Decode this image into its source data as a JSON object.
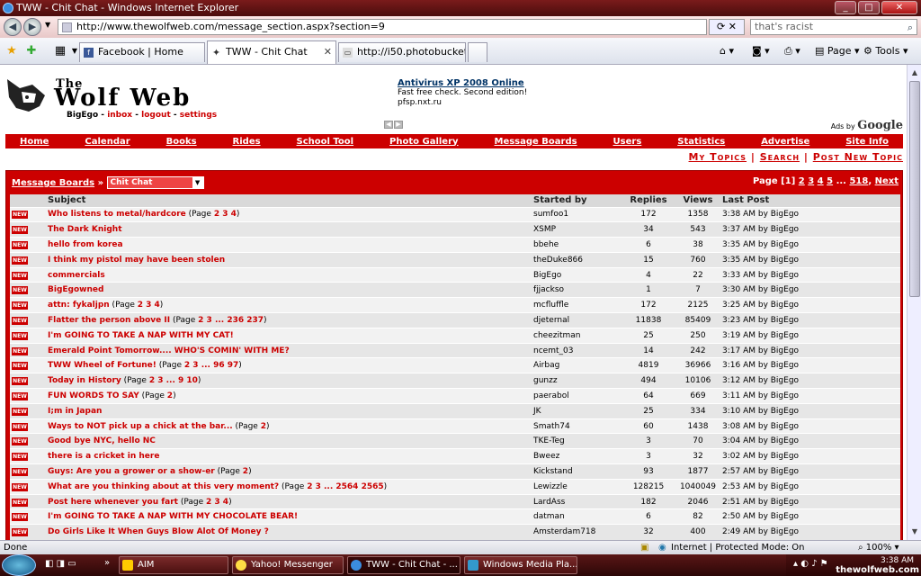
{
  "window": {
    "title": "TWW - Chit Chat - Windows Internet Explorer"
  },
  "address": {
    "url": "http://www.thewolfweb.com/message_section.aspx?section=9",
    "search_text": "that's racist"
  },
  "tabs": [
    {
      "label": "Facebook | Home"
    },
    {
      "label": "TWW - Chit Chat"
    },
    {
      "label": "http://i50.photobucket.co..."
    }
  ],
  "toolbar": {
    "page_label": "Page",
    "tools_label": "Tools"
  },
  "site": {
    "logo_line1": "The",
    "logo_line2": "Wolf Web",
    "user": "BigEgo",
    "inbox": "inbox",
    "logout": "logout",
    "settings": "settings"
  },
  "ad": {
    "title": "Antivirus XP 2008 Online",
    "line1": "Fast free check. Second edition!",
    "line2": "pfsp.nxt.ru",
    "ads_by": "Ads by",
    "google": "Google"
  },
  "nav": [
    "Home",
    "Calendar",
    "Books",
    "Rides",
    "School Tool",
    "Photo Gallery",
    "Message Boards",
    "Users",
    "Statistics",
    "Advertise",
    "Site Info"
  ],
  "subnav": {
    "my_topics": "My Topics",
    "search": "Search",
    "post_new": "Post New Topic"
  },
  "board": {
    "crumb": "Message Boards",
    "section": "Chit Chat",
    "pages_prefix": "Page",
    "current_page": "[1]",
    "pages": [
      "2",
      "3",
      "4",
      "5"
    ],
    "last_page": "518",
    "next": "Next"
  },
  "table": {
    "headers": {
      "subject": "Subject",
      "started": "Started by",
      "replies": "Replies",
      "views": "Views",
      "last": "Last Post"
    },
    "new_badge": "NEW",
    "rows": [
      {
        "title": "Who listens to metal/hardcore",
        "pages": "2 3 4",
        "by": "sumfoo1",
        "replies": "172",
        "views": "1358",
        "last": "3:38 AM by BigEgo"
      },
      {
        "title": "The Dark Knight",
        "pages": "",
        "by": "XSMP",
        "replies": "34",
        "views": "543",
        "last": "3:37 AM by BigEgo"
      },
      {
        "title": "hello from korea",
        "pages": "",
        "by": "bbehe",
        "replies": "6",
        "views": "38",
        "last": "3:35 AM by BigEgo"
      },
      {
        "title": "I think my pistol may have been stolen",
        "pages": "",
        "by": "theDuke866",
        "replies": "15",
        "views": "760",
        "last": "3:35 AM by BigEgo"
      },
      {
        "title": "commercials",
        "pages": "",
        "by": "BigEgo",
        "replies": "4",
        "views": "22",
        "last": "3:33 AM by BigEgo"
      },
      {
        "title": "BigEgowned",
        "pages": "",
        "by": "fjjackso",
        "replies": "1",
        "views": "7",
        "last": "3:30 AM by BigEgo"
      },
      {
        "title": "attn: fykaljpn",
        "pages": "2 3 4",
        "by": "mcfluffle",
        "replies": "172",
        "views": "2125",
        "last": "3:25 AM by BigEgo"
      },
      {
        "title": "Flatter the person above II",
        "pages": "2 3 ... 236 237",
        "by": "djeternal",
        "replies": "11838",
        "views": "85409",
        "last": "3:23 AM by BigEgo"
      },
      {
        "title": "I'm GOING TO TAKE A NAP WITH MY CAT!",
        "pages": "",
        "by": "cheezitman",
        "replies": "25",
        "views": "250",
        "last": "3:19 AM by BigEgo"
      },
      {
        "title": "Emerald Point Tomorrow.... WHO'S COMIN' WITH ME?",
        "pages": "",
        "by": "ncemt_03",
        "replies": "14",
        "views": "242",
        "last": "3:17 AM by BigEgo"
      },
      {
        "title": "TWW Wheel of Fortune!",
        "pages": "2 3 ... 96 97",
        "by": "Airbag",
        "replies": "4819",
        "views": "36966",
        "last": "3:16 AM by BigEgo"
      },
      {
        "title": "Today in History",
        "pages": "2 3 ... 9 10",
        "by": "gunzz",
        "replies": "494",
        "views": "10106",
        "last": "3:12 AM by BigEgo"
      },
      {
        "title": "FUN WORDS TO SAY",
        "pages": "2",
        "by": "paerabol",
        "replies": "64",
        "views": "669",
        "last": "3:11 AM by BigEgo"
      },
      {
        "title": "I;m in Japan",
        "pages": "",
        "by": "JK",
        "replies": "25",
        "views": "334",
        "last": "3:10 AM by BigEgo"
      },
      {
        "title": "Ways to NOT pick up a chick at the bar...",
        "pages": "2",
        "by": "Smath74",
        "replies": "60",
        "views": "1438",
        "last": "3:08 AM by BigEgo"
      },
      {
        "title": "Good bye NYC, hello NC",
        "pages": "",
        "by": "TKE-Teg",
        "replies": "3",
        "views": "70",
        "last": "3:04 AM by BigEgo"
      },
      {
        "title": "there is a cricket in here",
        "pages": "",
        "by": "Bweez",
        "replies": "3",
        "views": "32",
        "last": "3:02 AM by BigEgo"
      },
      {
        "title": "Guys: Are you a grower or a show-er",
        "pages": "2",
        "by": "Kickstand",
        "replies": "93",
        "views": "1877",
        "last": "2:57 AM by BigEgo"
      },
      {
        "title": "What are you thinking about at this very moment?",
        "pages": "2 3 ... 2564 2565",
        "by": "Lewizzle",
        "replies": "128215",
        "views": "1040049",
        "last": "2:53 AM by BigEgo"
      },
      {
        "title": "Post here whenever you fart",
        "pages": "2 3 4",
        "by": "LardAss",
        "replies": "182",
        "views": "2046",
        "last": "2:51 AM by BigEgo"
      },
      {
        "title": "I'm GOING TO TAKE A NAP WITH MY CHOCOLATE BEAR!",
        "pages": "",
        "by": "datman",
        "replies": "6",
        "views": "82",
        "last": "2:50 AM by BigEgo"
      },
      {
        "title": "Do Girls Like It When Guys Blow Alot Of Money ?",
        "pages": "",
        "by": "Amsterdam718",
        "replies": "32",
        "views": "400",
        "last": "2:49 AM by BigEgo"
      }
    ]
  },
  "status": {
    "text": "Done",
    "zone": "Internet | Protected Mode: On",
    "zoom": "100%"
  },
  "taskbar": {
    "items": [
      "AIM",
      "Yahoo! Messenger",
      "TWW - Chit Chat - ...",
      "Windows Media Pla..."
    ],
    "tray_text": "thewolfweb.com",
    "clock": "3:38 AM"
  },
  "colors": {
    "brand_red": "#cc0000",
    "title_dark": "#4a0d0d"
  }
}
